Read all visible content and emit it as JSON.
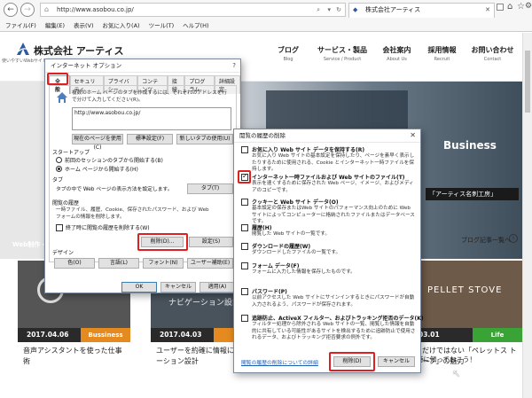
{
  "browser": {
    "url": "http://www.asobou.co.jp/",
    "tab_title": "株式会社アーティス",
    "menu": [
      "ファイル(F)",
      "編集(E)",
      "表示(V)",
      "お気に入り(A)",
      "ツール(T)",
      "ヘルプ(H)"
    ]
  },
  "site": {
    "logo_text": "株式会社 アーティス",
    "tagline": "使いやすいWebサイトを",
    "nav": [
      {
        "title": "ブログ",
        "sub": "Blog"
      },
      {
        "title": "サービス・製品",
        "sub": "Service / Product"
      },
      {
        "title": "会社案内",
        "sub": "About Us"
      },
      {
        "title": "採用情報",
        "sub": "Recruit"
      },
      {
        "title": "お問い合わせ",
        "sub": "Contact"
      }
    ],
    "hero_left_text": "Web制作・",
    "hero_business": "Business",
    "hero_right_text": "「アーティス名刺工房」",
    "blog_more": "ブログ記事一覧へ",
    "cards": [
      {
        "date": "2017.04.06",
        "category": "Bussiness",
        "title": "音声アシスタントを使った仕事術",
        "cat_color": "#e58a1f"
      },
      {
        "date": "2017.04.03",
        "category": "W",
        "title": "ユーザーを約確に情報に導く ゲーション設計",
        "cat_color": "#e58a1f",
        "img_text": "ナビゲーション設計"
      },
      {
        "date": "03.01",
        "category": "Life",
        "title": "だけではない「ペレットス トーブ」の魅力",
        "cat_color": "#3aa336",
        "img_text": "PELLET STOVE"
      }
    ],
    "cards_partial_text": "時に知っておこう！"
  },
  "internet_options": {
    "title": "インターネット オプション",
    "tabs": [
      "全般",
      "セキュリティ",
      "プライバシー",
      "コンテンツ",
      "接続",
      "プログラム",
      "詳細設定"
    ],
    "home_desc": "複数のホーム ページのタブを作成するには、それぞれのアドレスを行で分けて入力してください(R)。",
    "home_url": "http://www.asobou.co.jp/",
    "btn_use_current": "現在のページを使用(C)",
    "btn_use_default": "標準設定(F)",
    "btn_use_new_tab": "新しいタブの使用(U)",
    "startup_label": "スタートアップ",
    "startup_opt1": "前回のセッションのタブから開始する(B)",
    "startup_opt2": "ホーム ページから開始する(H)",
    "tabs_label": "タブ",
    "tabs_desc": "タブの中で Web ページの表示方法を設定します。",
    "btn_tabs": "タブ(T)",
    "history_label": "閲覧の履歴",
    "history_desc": "一時ファイル、履歴、Cookie、保存されたパスワード、および Web フォームの情報を削除します。",
    "history_check": "終了時に閲覧の履歴を削除する(W)",
    "btn_delete": "削除(D)...",
    "btn_settings": "設定(S)",
    "design_label": "デザイン",
    "btn_colors": "色(O)",
    "btn_languages": "言語(L)",
    "btn_fonts": "フォント(N)",
    "btn_accessibility": "ユーザー補助(E)",
    "btn_ok": "OK",
    "btn_cancel": "キャンセル",
    "btn_apply": "適用(A)"
  },
  "delete_history": {
    "title": "閲覧の履歴の削除",
    "items": [
      {
        "label": "お気に入り Web サイト データを保持する(R)",
        "desc": "お気に入り Web サイトの基本設定を保持したり、ページを素早く表示したりするために使用される、Cookie とインターネット一時ファイルを保持します。",
        "checked": false
      },
      {
        "label": "インターネット一時ファイルおよび Web サイトのファイル(T)",
        "desc": "表示を速くするために保存された Web ページ、イメージ、およびメディアのコピーです。",
        "checked": true
      },
      {
        "label": "クッキーと Web サイト データ(O)",
        "desc": "基本設定の保存またはWeb サイトのパフォーマンス向上のために Web サイトによってコンピューターに格納されたファイルまたはデータベースです。",
        "checked": false
      },
      {
        "label": "履歴(H)",
        "desc": "閲覧した Web サイトの一覧です。",
        "checked": false
      },
      {
        "label": "ダウンロードの履歴(W)",
        "desc": "ダウンロードしたファイルの一覧です。",
        "checked": false
      },
      {
        "label": "フォーム データ(F)",
        "desc": "フォームに入力した情報を保存したものです。",
        "checked": false
      },
      {
        "label": "パスワード(P)",
        "desc": "以前アクセスした Web サイトにサインインするときにパスワードが自動入力されるよう、パスワードが保存されます。",
        "checked": false
      },
      {
        "label": "追跡防止、ActiveX フィルター、およびトラッキング拒否のデータ(K)",
        "desc": "フィルター処理から除外される Web サイトの一覧、閲覧した情報を自動的に共有している可能性があるサイトを検出するために追跡防止で使用されるデータ、およびトラッキング拒否要求の例外です。",
        "checked": false
      }
    ],
    "link": "閲覧の履歴の削除についての詳細",
    "btn_delete": "削除(D)",
    "btn_cancel": "キャンセル"
  }
}
